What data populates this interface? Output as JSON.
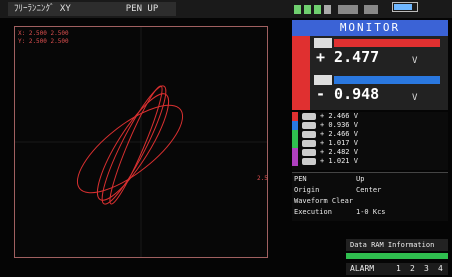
{
  "header": {
    "mode_label": "ﾌﾘｰﾗﾝﾆﾝｸﾞ XY",
    "pen_label": "PEN UP"
  },
  "plot": {
    "cursor_lines": [
      "X: 2.500  2.500",
      "Y: 2.500  2.500"
    ],
    "scale_label": "2.5"
  },
  "monitor": {
    "title": "MONITOR",
    "channels": [
      {
        "value": "+ 2.477",
        "unit": "V",
        "bar_color": "#e03030"
      },
      {
        "value": "- 0.948",
        "unit": "V",
        "bar_color": "#2a78e0"
      }
    ]
  },
  "channel_list": [
    {
      "value": "+ 2.466  V",
      "color": "#e03030"
    },
    {
      "value": "+ 0.936  V",
      "color": "#2a78e0"
    },
    {
      "value": "+ 2.466  V",
      "color": "#2fbf4f"
    },
    {
      "value": "+ 1.017  V",
      "color": "#2fbf4f"
    },
    {
      "value": "+ 2.482  V",
      "color": "#b040c0"
    },
    {
      "value": "+ 1.021  V",
      "color": "#b040c0"
    }
  ],
  "settings": [
    {
      "key": "PEN",
      "value": "Up"
    },
    {
      "key": "Origin",
      "value": "Center"
    },
    {
      "key": "Waveform Clear",
      "value": ""
    },
    {
      "key": "Execution",
      "value": "1-0 Kcs"
    }
  ],
  "footer": {
    "data_info": "Data RAM Information",
    "alarm_label": "ALARM",
    "alarm_numbers": [
      "1",
      "2",
      "3",
      "4"
    ]
  },
  "colors": {
    "accent": "#3b63d6",
    "trace": "#e03030"
  }
}
